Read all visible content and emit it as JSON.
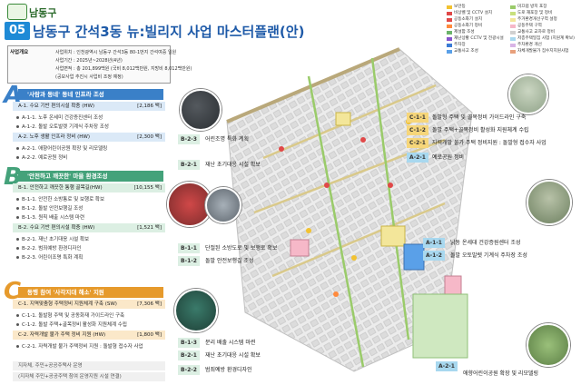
{
  "header": {
    "logo_text": "남동구",
    "page_number": "05",
    "title": "남동구 간석3동 뉴:빌리지 사업 마스터플랜(안)"
  },
  "overview": {
    "label": "사업개요",
    "lines": [
      "사업위치 : 인천광역시 남동구 간석3동 80-1번지 간석여중 일원",
      "사업기간 : 2025년~2028년(4년)",
      "사업면적 : 총 201,899백원 (국비 8,012백만원, 지방비 8,012백만원)",
      "(공모사업 추진시 사업비 조정 예정)"
    ]
  },
  "sections": {
    "a": {
      "letter": "A",
      "title": "'사람과 동네' 동네 인프라 조성",
      "sub1_label": "A-1. 수요 기반 편의시설 확충 (HW)",
      "sub1_amount": "[2,186 백]",
      "sub1_items": [
        "A-1-1. 노후 온세미 건강증진센터 조성",
        "A-1-2. 돌발 오토발렛 기계식 주차장 조성"
      ],
      "sub2_label": "A-2. 노후 생활 인프라 정비 (HW)",
      "sub2_amount": "[2,300 백]",
      "sub2_items": [
        "A-2-1. 애향어린이공원 확장 및 리모델링",
        "A-2-2. 예로공원 정비"
      ]
    },
    "b": {
      "letter": "B",
      "title": "'안전하고 깨끗한' 마을 환경조성",
      "sub1_label": "B-1. 안전하고 깨끗한 통행 골목길(HW)",
      "sub1_amount": "[10,155 백]",
      "sub1_items": [
        "B-1-1. 안전한 소방통로 및 보행로 확보",
        "B-1-2. 돌발 안전보행길 조성",
        "B-1-3. 원칙 배출 시스템 마련"
      ],
      "sub2_label": "B-2. 수요 기반 편의시설 확충 (HW)",
      "sub2_amount": "[1,521 백]",
      "sub2_items": [
        "B-2-1. 재난 초기대응 시설 확보",
        "B-2-2. 범죄예방 환경디자인",
        "B-2-3. 어린이조명 특화 계획"
      ]
    },
    "c": {
      "letter": "C",
      "title": "동행 참여 '사각지대 해소' 지원",
      "sub1_label": "C-1. 지역맞춤형 주택정비 지원체계 구축 (SW)",
      "sub1_amount": "[7,306 백]",
      "sub1_items": [
        "C-1-1. 돌발형 주택 및 공동화재 가이드라인 구축",
        "C-1-2. 돌발 주택+골목정비 활성화 지원체계 수립"
      ],
      "sub2_label": "C-2. 자력개발 불가 주택 정비 지원 (HW)",
      "sub2_amount": "[1,800 백]",
      "sub2_items": [
        "C-2-1. 자력개발 불가 주택정비 지원 : 돌발형 접수자 사업"
      ],
      "footer1": "지자체, 주민+공공주택사 운영",
      "footer2": "(지자체 주민+공공주택 참여 운영지원 시설 연결)"
    }
  },
  "map_labels": [
    {
      "code": "C-1-1",
      "desc": "돌발형 주택 및 골목정비 가이드라인 구축"
    },
    {
      "code": "C-1-2",
      "desc": "돌발 주택+골목정비 활성화 지원체계 수립"
    },
    {
      "code": "C-2-1",
      "desc": "자력개발 불가 주택 정비지원 : 돌발형 접수자 사업"
    },
    {
      "code": "A-2-1",
      "desc": "예로공원 정비"
    },
    {
      "code": "B-2-3",
      "desc": "어린조명 특화 계획"
    },
    {
      "code": "B-2-1",
      "desc": "재난 초기대응 시설 확보"
    },
    {
      "code": "B-1-1",
      "desc": "단절된 소방도로 및 보행로 확보"
    },
    {
      "code": "B-1-2",
      "desc": "돌발 안전보행길 조성"
    },
    {
      "code": "A-1-1",
      "desc": "낡동 온세대 건강증원센터 조성"
    },
    {
      "code": "A-1-2",
      "desc": "돌발 오토발렛 기계식 주차장 조성"
    },
    {
      "code": "B-1-3",
      "desc": "분리 배출 시스템 마련"
    },
    {
      "code": "B-2-1",
      "desc": "재난 초기대응 시설 확보"
    },
    {
      "code": "B-2-2",
      "desc": "범죄예방 환경디자인"
    },
    {
      "code": "A-2-1",
      "desc": "애향어린이공원 확장 및 리모델링"
    }
  ],
  "legend": {
    "items": [
      {
        "label": "보안등",
        "color": "#f2c230"
      },
      {
        "label": "비상벨 및 CCTV 설치",
        "color": "#e04848"
      },
      {
        "label": "공동소화기 설치",
        "color": "#e04848"
      },
      {
        "label": "공동소화기 정비",
        "color": "#ff8a3d"
      },
      {
        "label": "제설함 조성",
        "color": "#6bb36b"
      },
      {
        "label": "재난상황 CCTV 및 전광시설",
        "color": "#8855cc"
      },
      {
        "label": "주차장",
        "color": "#3a7bd5"
      },
      {
        "label": "교통사고 조성",
        "color": "#5aa0e8"
      },
      {
        "label": "미끄럼 방지 포장",
        "color": "#9acb6a"
      },
      {
        "label": "도로 재포장 및 정비",
        "color": "#c8e07c"
      },
      {
        "label": "주거환경개선구역 설정",
        "color": "#f3e69a"
      },
      {
        "label": "공동주택 구역",
        "color": "#f6b8c8"
      },
      {
        "label": "교통사고 교차로 정비",
        "color": "#d0d0d0"
      },
      {
        "label": "저층주택밀집 사업 (지원계 확보)",
        "color": "#a8d8ef"
      },
      {
        "label": "주차환경 개선",
        "color": "#d8b4e6"
      },
      {
        "label": "자체개발불가 집수지지원사업",
        "color": "#e8a07c"
      }
    ]
  },
  "colors": {
    "section_a": "#3a80c8",
    "section_b": "#44a27a",
    "section_c": "#e69a2c",
    "title_blue": "#1e5aa8"
  }
}
